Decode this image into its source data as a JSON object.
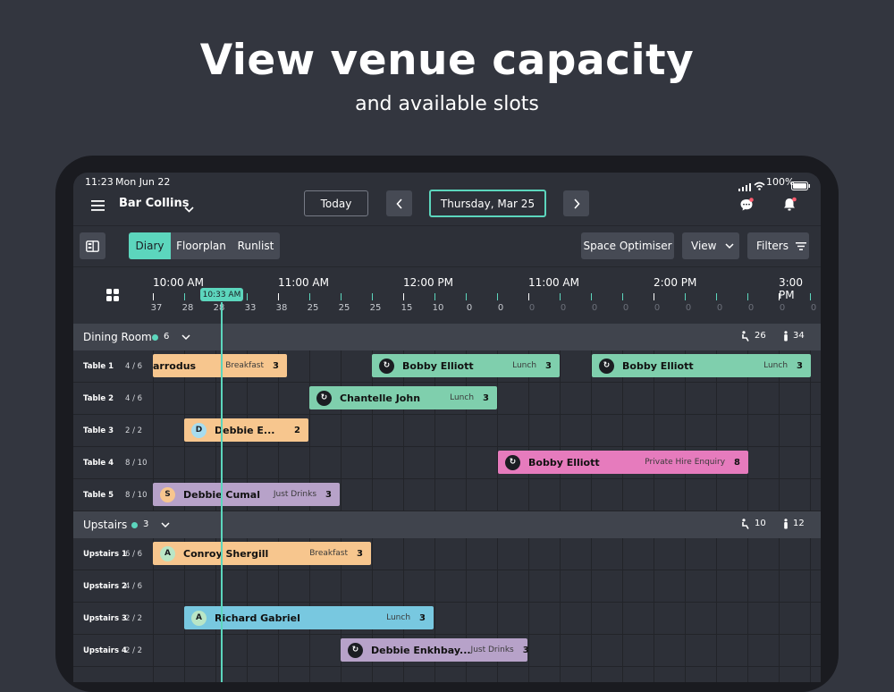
{
  "hero": {
    "title": "View venue capacity",
    "subtitle": "and available slots"
  },
  "statusbar": {
    "time": "11:23",
    "date": "Mon Jun 22",
    "battery": "100%"
  },
  "topbar": {
    "venue": "Bar Collins",
    "today_label": "Today",
    "date_label": "Thursday, Mar 25"
  },
  "toolbar": {
    "tabs": [
      "Diary",
      "Floorplan",
      "Runlist"
    ],
    "active_tab": "Diary",
    "space_optimiser": "Space Optimiser",
    "view": "View",
    "filters": "Filters"
  },
  "timeline": {
    "hours": [
      "10:00 AM",
      "11:00 AM",
      "12:00 PM",
      "11:00 AM",
      "2:00 PM",
      "3:00 PM"
    ],
    "now": "10:33 AM",
    "counts": [
      "37",
      "28",
      "28",
      "33",
      "38",
      "25",
      "25",
      "25",
      "15",
      "10",
      "0",
      "0",
      "0",
      "0",
      "0",
      "0",
      "0",
      "0",
      "0",
      "0",
      "0",
      "0"
    ]
  },
  "sections": [
    {
      "name": "Dining Room",
      "count": "6",
      "covers_seated": "26",
      "covers_standing": "34",
      "tables": [
        {
          "name": "Table 1",
          "capacity": "4 / 6"
        },
        {
          "name": "Table 2",
          "capacity": "4 / 6"
        },
        {
          "name": "Table 3",
          "capacity": "2 / 2"
        },
        {
          "name": "Table 4",
          "capacity": "8 / 10"
        },
        {
          "name": "Table 5",
          "capacity": "8 / 10"
        }
      ]
    },
    {
      "name": "Upstairs",
      "count": "3",
      "covers_seated": "10",
      "covers_standing": "12",
      "tables": [
        {
          "name": "Upstairs 1",
          "capacity": "6 / 6"
        },
        {
          "name": "Upstairs 2",
          "capacity": "4 / 6"
        },
        {
          "name": "Upstairs 3",
          "capacity": "2 / 2"
        },
        {
          "name": "Upstairs 4",
          "capacity": "2 / 2"
        }
      ]
    }
  ],
  "bookings": [
    {
      "name": "arrodus",
      "type": "Breakfast",
      "covers": "3",
      "avatar": "",
      "color": "#f7c68e"
    },
    {
      "name": "Bobby Elliott",
      "type": "Lunch",
      "covers": "3",
      "avatar": "↻",
      "color": "#7fcfad"
    },
    {
      "name": "Bobby Elliott",
      "type": "Lunch",
      "covers": "3",
      "avatar": "↻",
      "color": "#7fcfad"
    },
    {
      "name": "Chantelle John",
      "type": "Lunch",
      "covers": "3",
      "avatar": "↻",
      "color": "#7fcfad"
    },
    {
      "name": "Debbie E...",
      "type": "",
      "covers": "2",
      "avatar": "D",
      "color": "#f7c68e"
    },
    {
      "name": "Bobby Elliott",
      "type": "Private Hire Enquiry",
      "covers": "8",
      "avatar": "↻",
      "color": "#e67bbd"
    },
    {
      "name": "Debbie Cumal",
      "type": "Just Drinks",
      "covers": "3",
      "avatar": "S",
      "color": "#b7a2c9"
    },
    {
      "name": "Conroy Shergill",
      "type": "Breakfast",
      "covers": "3",
      "avatar": "A",
      "color": "#f7c68e"
    },
    {
      "name": "Richard Gabriel",
      "type": "Lunch",
      "covers": "3",
      "avatar": "A",
      "color": "#78c8e0"
    },
    {
      "name": "Debbie Enkhbay...",
      "type": "Just Drinks",
      "covers": "3",
      "avatar": "↻",
      "color": "#b7a2c9"
    }
  ]
}
